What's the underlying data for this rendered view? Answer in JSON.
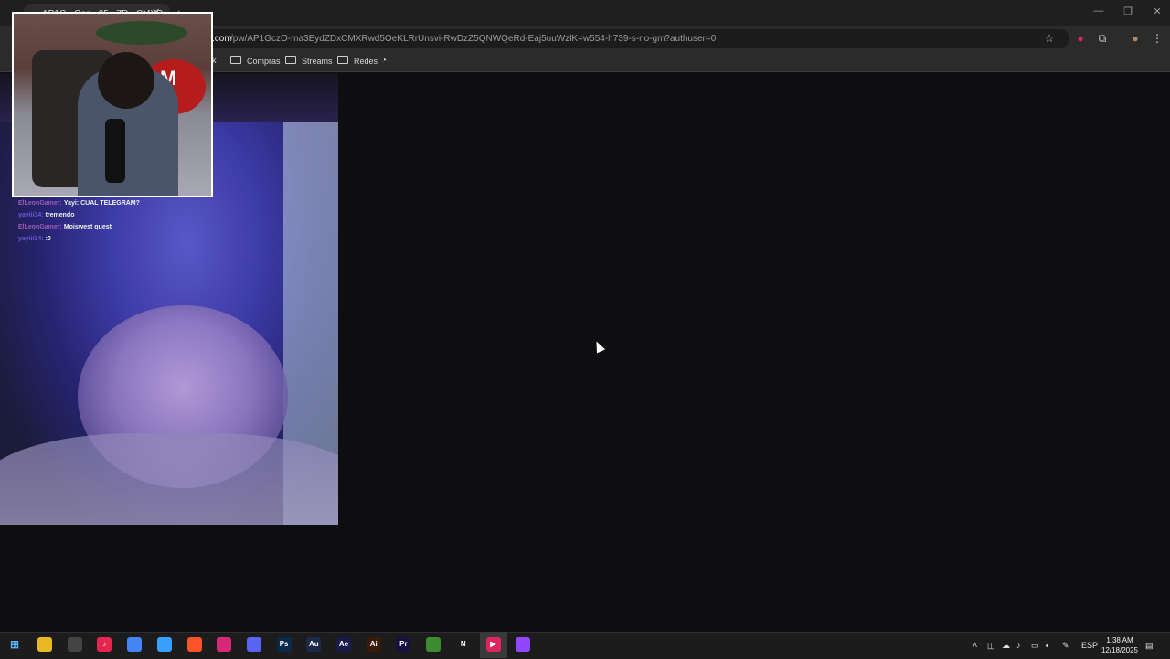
{
  "browser": {
    "tab_title": "AP1G...Oce...25...ZD...CMXR",
    "url_domain": ".com",
    "url_path": "/pw/AP1GczO-ma3EydZDxCMXRwd5OeKLRrUnsvi-RwDzZ5QNWQeRd-Eaj5uuWzlK=w554-h739-s-no-gm?authuser=0",
    "bookmark_partial": "rk",
    "bookmarks": [
      {
        "label": "Compras"
      },
      {
        "label": "Streams"
      },
      {
        "label": "Redes"
      }
    ],
    "window_controls": {
      "minimize": "—",
      "restore": "❐",
      "close": "✕"
    }
  },
  "stream_overlay": {
    "chat": [
      {
        "user": "ElLeonGamer:",
        "message": "Yayi: CUAL TELEGRAM?",
        "user_color": "#9b59b6"
      },
      {
        "user": "yayiii34:",
        "message": "tremendo",
        "user_color": "#6a5acd"
      },
      {
        "user": "ElLeonGamer:",
        "message": "Moiswest quest",
        "user_color": "#9b59b6"
      },
      {
        "user": "yayiii34:",
        "message": ":0",
        "user_color": "#6a5acd"
      }
    ],
    "plush_letter": "M"
  },
  "taskbar": {
    "apps": [
      {
        "name": "file-explorer-icon",
        "glyph": "",
        "color": "#e8b923"
      },
      {
        "name": "capture-icon",
        "glyph": "",
        "color": "#444"
      },
      {
        "name": "tiktok-icon",
        "glyph": "♪",
        "color": "#e5264f"
      },
      {
        "name": "chrome-icon",
        "glyph": "",
        "color": "#4285f4"
      },
      {
        "name": "copilot-icon",
        "glyph": "",
        "color": "#3aa0ff"
      },
      {
        "name": "brave-icon",
        "glyph": "",
        "color": "#fb542b"
      },
      {
        "name": "instagram-icon",
        "glyph": "",
        "color": "#d62976"
      },
      {
        "name": "discord-icon",
        "glyph": "",
        "color": "#5865f2"
      },
      {
        "name": "photoshop-icon",
        "glyph": "Ps",
        "color": "#0a2a4a"
      },
      {
        "name": "audition-icon",
        "glyph": "Au",
        "color": "#1c2a4a"
      },
      {
        "name": "after-effects-icon",
        "glyph": "Ae",
        "color": "#1a1a4a"
      },
      {
        "name": "illustrator-icon",
        "glyph": "Ai",
        "color": "#3a1a08"
      },
      {
        "name": "premiere-icon",
        "glyph": "Pr",
        "color": "#1a1040"
      },
      {
        "name": "minecraft-icon",
        "glyph": "",
        "color": "#3c8d2f"
      },
      {
        "name": "netflix-icon",
        "glyph": "N",
        "color": "#1c1c1c"
      },
      {
        "name": "media-player-icon",
        "glyph": "▶",
        "color": "#e0245e"
      },
      {
        "name": "obs-icon",
        "glyph": "",
        "color": "#9146ff"
      }
    ],
    "language": "ESP",
    "time": "1:38 AM",
    "date": "12/18/2025"
  }
}
